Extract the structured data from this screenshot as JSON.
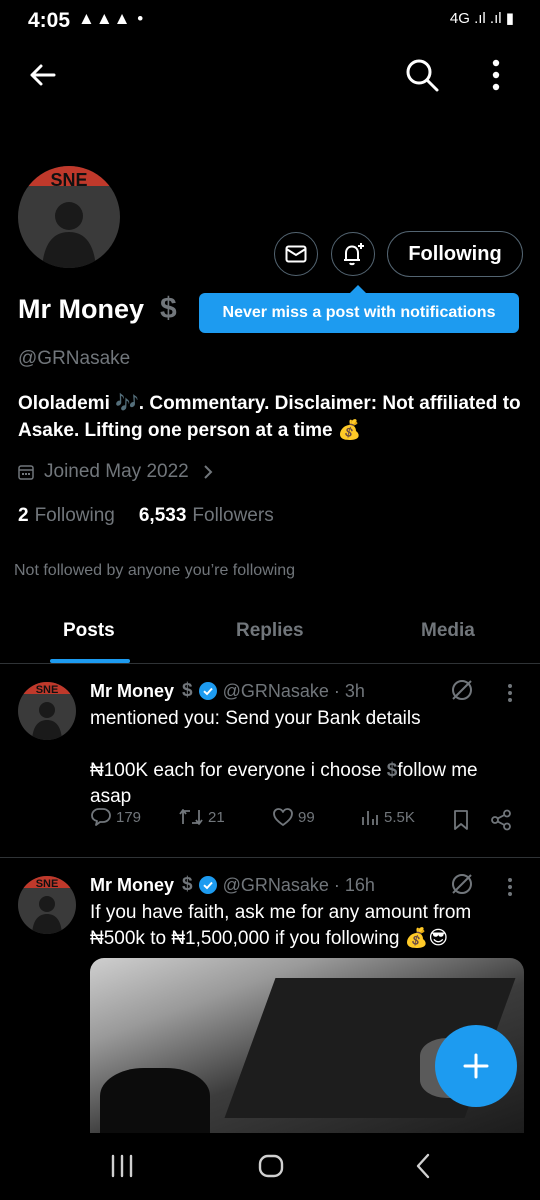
{
  "status_bar": {
    "time": "4:05",
    "notification_icons": "▲▲▲",
    "dot": "•",
    "right_indicators": "4G .ıl .ıl ▮"
  },
  "profile": {
    "display_name": "Mr Money",
    "badge": "$",
    "handle": "@GRNasake",
    "bio": "Ololademi 🎶. Commentary. Disclaimer: Not affiliated to Asake. Lifting one person at a time 💰",
    "joined": "Joined May 2022",
    "following_count": "2",
    "following_label": "Following",
    "followers_count": "6,533",
    "followers_label": "Followers",
    "not_followed_text": "Not followed by anyone you’re following",
    "avatar_text": "SNE"
  },
  "actions": {
    "following_button": "Following"
  },
  "tooltip": {
    "text": "Never miss a post with notifications"
  },
  "tabs": [
    {
      "label": "Posts"
    },
    {
      "label": "Replies"
    },
    {
      "label": "Media"
    }
  ],
  "posts": [
    {
      "name": "Mr Money",
      "badge": "$",
      "handle_time": "@GRNasake · 3h",
      "text_line1": "mentioned you: Send your Bank details",
      "text_line2": "₦100K each for everyone i choose",
      "text_line2b": "$",
      "text_line2c": "follow me",
      "text_line3": "asap",
      "replies": "179",
      "reposts": "21",
      "likes": "99",
      "views": "5.5K"
    },
    {
      "name": "Mr Money",
      "badge": "$",
      "handle_time": "@GRNasake · 16h",
      "text_line1": "If you have faith, ask me for any amount from",
      "text_line2": "₦500k to ₦1,500,000 if you following 💰😎"
    }
  ],
  "colors": {
    "accent": "#1d9bf0",
    "background": "#000000",
    "muted_text": "#71767b",
    "border": "#2f3336"
  },
  "icons": [
    "back-arrow-icon",
    "search-icon",
    "more-vertical-icon",
    "mail-icon",
    "bell-plus-icon",
    "calendar-icon",
    "chevron-right-icon",
    "verified-icon",
    "grok-icon",
    "reply-icon",
    "repost-icon",
    "like-icon",
    "views-icon",
    "bookmark-icon",
    "share-icon",
    "compose-plus-icon"
  ]
}
